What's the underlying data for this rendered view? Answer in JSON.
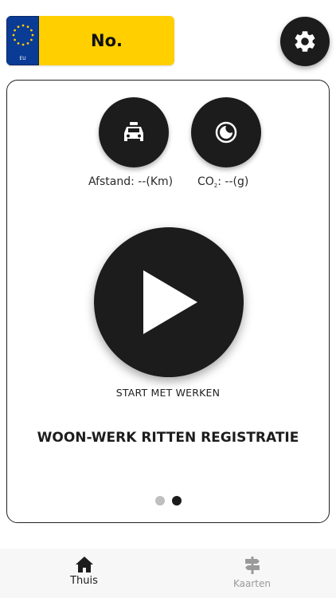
{
  "license_plate": {
    "country_label": "EU",
    "number": "No."
  },
  "settings": {
    "icon": "gear-icon"
  },
  "stats": {
    "distance": {
      "icon": "taxi-icon",
      "label": "Afstand: --(Km)"
    },
    "co2": {
      "icon": "co2-icon",
      "label_prefix": "CO",
      "label_subscript": "2",
      "label_suffix": ": --(g)"
    }
  },
  "start": {
    "icon": "play-icon",
    "label": "START MET WERKEN"
  },
  "card": {
    "title": "WOON-WERK RITTEN REGISTRATIE",
    "pages": 2,
    "active_page": 2
  },
  "tabbar": {
    "tabs": [
      {
        "label": "Thuis",
        "icon": "home-icon",
        "active": true
      },
      {
        "label": "Kaarten",
        "icon": "signpost-icon",
        "active": false
      }
    ]
  },
  "colors": {
    "plate_yellow": "#ffcf00",
    "eu_blue": "#0a3b95",
    "button_dark": "#1c1c1c",
    "inactive_gray": "#9a9a9a"
  }
}
